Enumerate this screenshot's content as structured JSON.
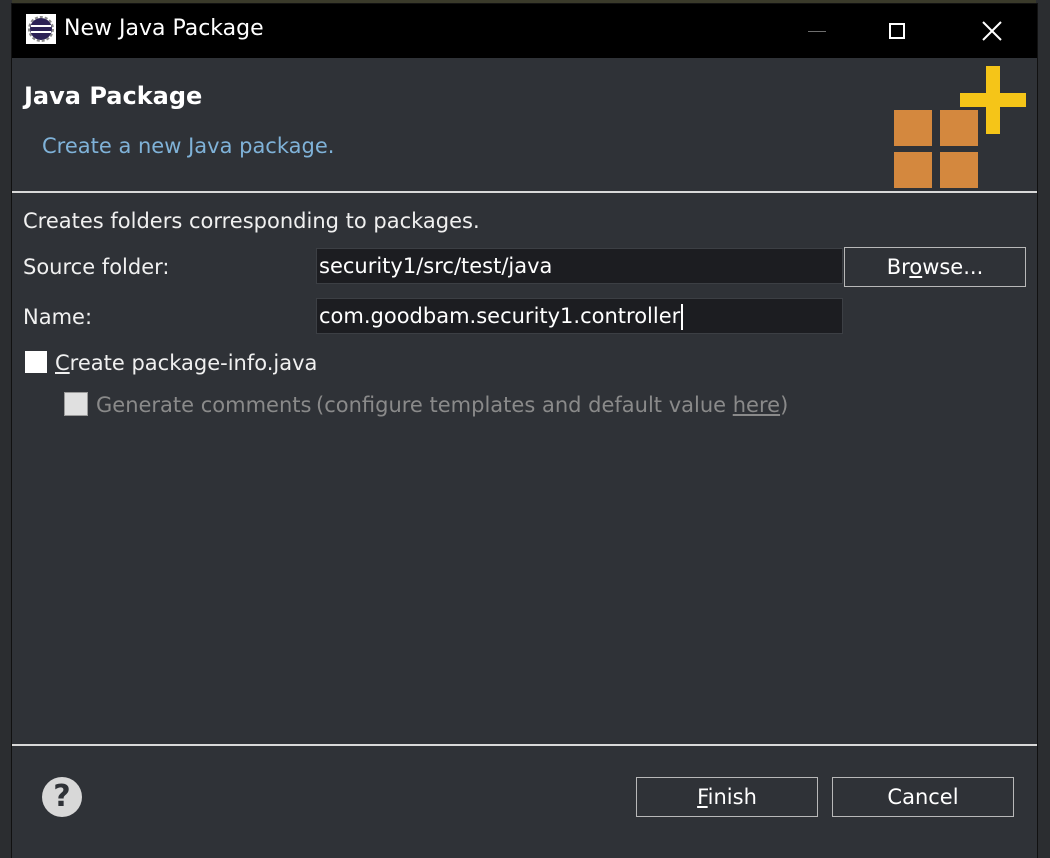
{
  "window": {
    "title": "New Java Package",
    "icon": "eclipse-icon",
    "controls": [
      "minimize-icon",
      "maximize-icon",
      "close-icon"
    ]
  },
  "header": {
    "title": "Java Package",
    "description": "Create a new Java package.",
    "graphic": "new-package-icon"
  },
  "body": {
    "intro": "Creates folders corresponding to packages.",
    "source_folder_label": "Source folder:",
    "source_folder_value": "security1/src/test/java",
    "browse_label_pre": "Br",
    "browse_label_key": "o",
    "browse_label_post": "wse...",
    "name_label": "Name:",
    "name_value": "com.goodbam.security1.controller",
    "create_pkg_info_key": "C",
    "create_pkg_info_rest": "reate package-info.java",
    "create_pkg_info_checked": false,
    "generate_comments_label": "Generate comments",
    "generate_comments_hint_pre": "(configure templates and default value ",
    "generate_comments_link": "here",
    "generate_comments_hint_post": ")",
    "generate_comments_enabled": false
  },
  "footer": {
    "help_icon": "help-icon",
    "finish_key": "F",
    "finish_rest": "inish",
    "cancel_label": "Cancel"
  },
  "colors": {
    "title_bar": "#000000",
    "dialog_bg": "#2f3237",
    "accent_text": "#7fb2d8",
    "package_orange": "#d4883e",
    "plus_yellow": "#f5c518"
  }
}
